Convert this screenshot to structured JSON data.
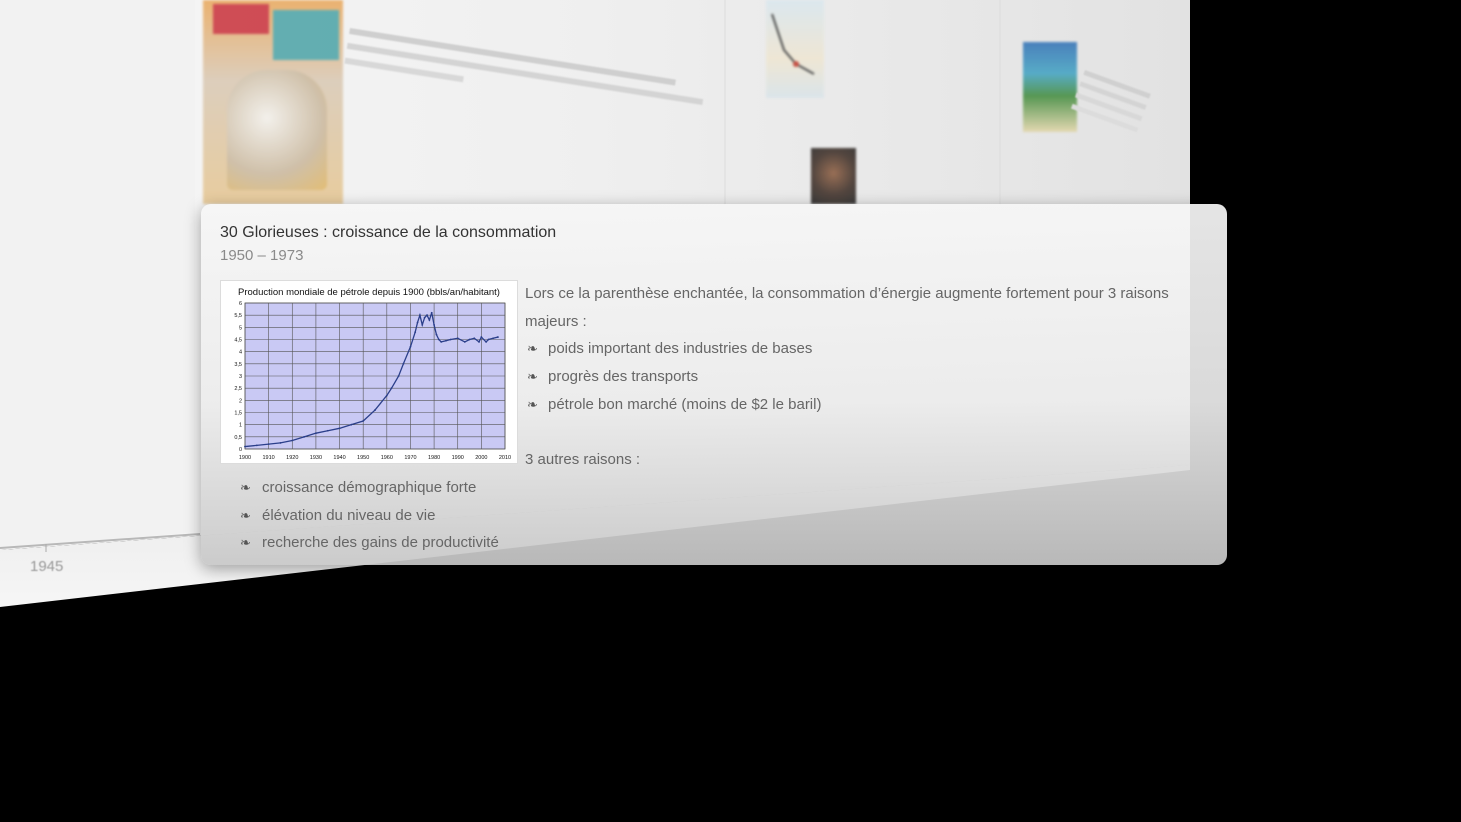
{
  "popup": {
    "title": "30 Glorieuses : croissance de la consommation",
    "dates": "1950 – 1973",
    "intro": "Lors ce la parenthèse enchantée, la consommation d’énergie augmente fortement pour 3 raisons majeurs :",
    "reasons": [
      "poids important des industries de bases",
      "progrès des transports",
      "pétrole bon marché (moins de $2 le baril)"
    ],
    "other_heading": "3 autres raisons :",
    "other_reasons": [
      "croissance démographique forte",
      "élévation du niveau de vie",
      "recherche des gains de productivité"
    ],
    "bullet_icon": "floral-heart-bullet-icon"
  },
  "timeline": {
    "visible_year": "1945"
  },
  "chart_data": {
    "type": "line",
    "title": "Production mondiale de pétrole depuis 1900 (bbls/an/habitant)",
    "xlabel": "",
    "ylabel": "",
    "xlim": [
      1900,
      2010
    ],
    "ylim": [
      0,
      6
    ],
    "xticks": [
      "1900",
      "1910",
      "1920",
      "1930",
      "1940",
      "1950",
      "1960",
      "1970",
      "1980",
      "1990",
      "2000",
      "2010"
    ],
    "yticks": [
      "0",
      "0,5",
      "1",
      "1,5",
      "2",
      "2,5",
      "3",
      "3,5",
      "4",
      "4,5",
      "5",
      "5,5",
      "6"
    ],
    "grid": true,
    "background_color": "#c9c9f4",
    "line_color": "#2b3f8a",
    "series": [
      {
        "x": [
          1900,
          1905,
          1910,
          1915,
          1920,
          1925,
          1930,
          1935,
          1940,
          1945,
          1950,
          1955,
          1960,
          1962,
          1965,
          1967,
          1970,
          1972,
          1973,
          1974,
          1975,
          1976,
          1977,
          1978,
          1979,
          1980,
          1981,
          1982,
          1983,
          1985,
          1987,
          1990,
          1993,
          1995,
          1997,
          1999,
          2000,
          2002,
          2003,
          2005,
          2007
        ],
        "values": [
          0.1,
          0.15,
          0.2,
          0.25,
          0.35,
          0.5,
          0.65,
          0.75,
          0.85,
          1.0,
          1.15,
          1.6,
          2.2,
          2.5,
          3.0,
          3.5,
          4.2,
          4.8,
          5.2,
          5.5,
          5.1,
          5.4,
          5.5,
          5.3,
          5.6,
          5.1,
          4.7,
          4.5,
          4.4,
          4.45,
          4.5,
          4.55,
          4.4,
          4.5,
          4.55,
          4.4,
          4.6,
          4.4,
          4.5,
          4.55,
          4.6
        ]
      }
    ]
  }
}
